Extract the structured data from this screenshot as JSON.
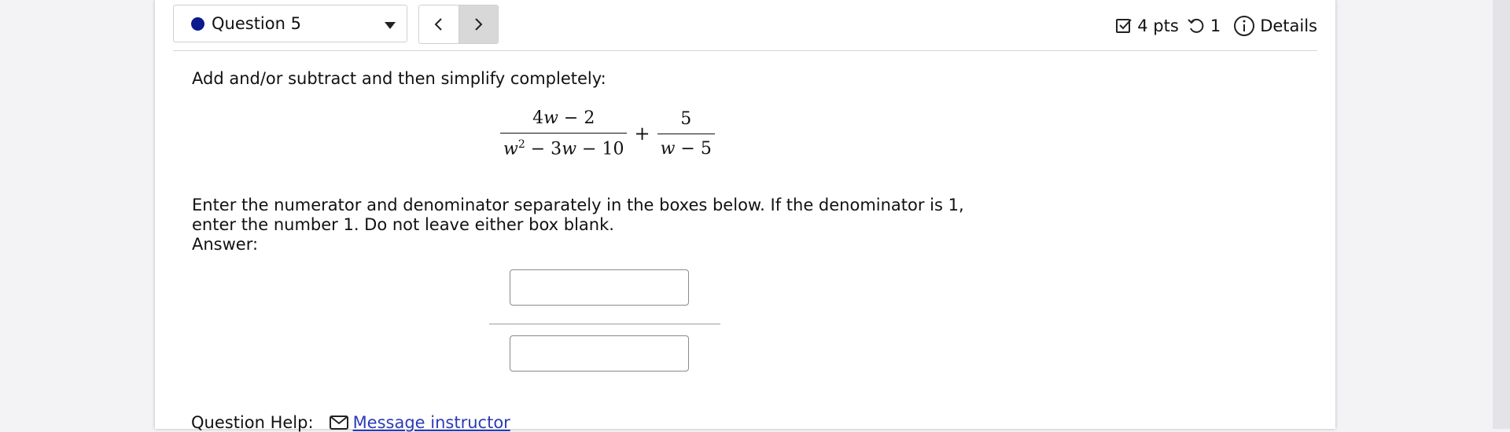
{
  "header": {
    "question_label": "Question 5",
    "status_color": "#0b1a8c",
    "points": "4 pts",
    "retries": "1",
    "details_label": "Details"
  },
  "question": {
    "prompt": "Add and/or subtract and then simplify completely:",
    "expression": {
      "frac1_num": {
        "coef": "4",
        "var": "w",
        "rest": " − 2"
      },
      "frac1_den": {
        "var1": "w",
        "exp": "2",
        "rest_a": " − 3",
        "var2": "w",
        "rest_b": " − 10"
      },
      "operator": "+",
      "frac2_num": "5",
      "frac2_den": {
        "var": "w",
        "rest": " − 5"
      }
    },
    "instructions": "Enter the numerator and denominator separately in the boxes below. If the denominator is 1, enter the number 1. Do not leave either box blank.",
    "answer_label": "Answer:",
    "numerator_value": "",
    "denominator_value": ""
  },
  "help": {
    "label": "Question Help:",
    "message_link": "Message instructor"
  }
}
